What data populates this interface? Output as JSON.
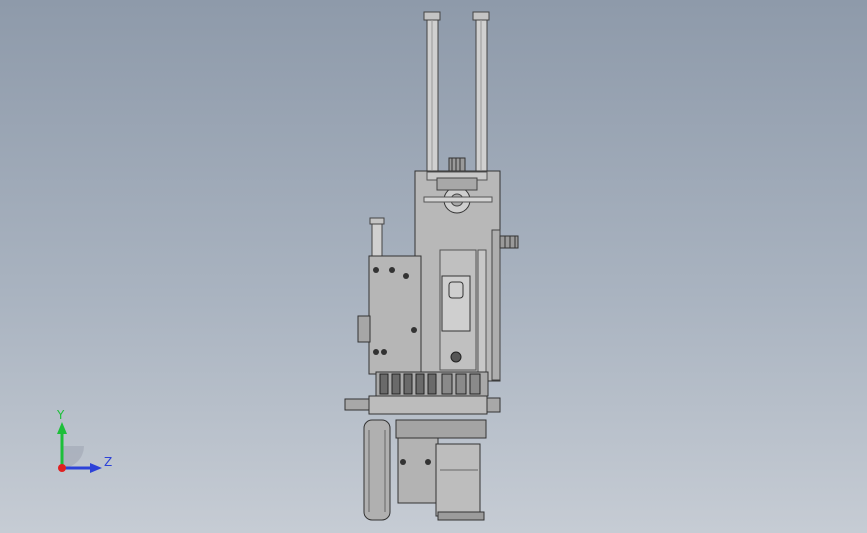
{
  "triad": {
    "y_label": "Y",
    "z_label": "Z",
    "colors": {
      "y": "#1dbf3a",
      "z": "#2c42d8",
      "x": "#e02020"
    }
  },
  "model": {
    "colors": {
      "metal": "#b5b5b5",
      "dark": "#3a3a3a",
      "shade": "#8c8c8c",
      "light": "#d6d6d6"
    }
  }
}
